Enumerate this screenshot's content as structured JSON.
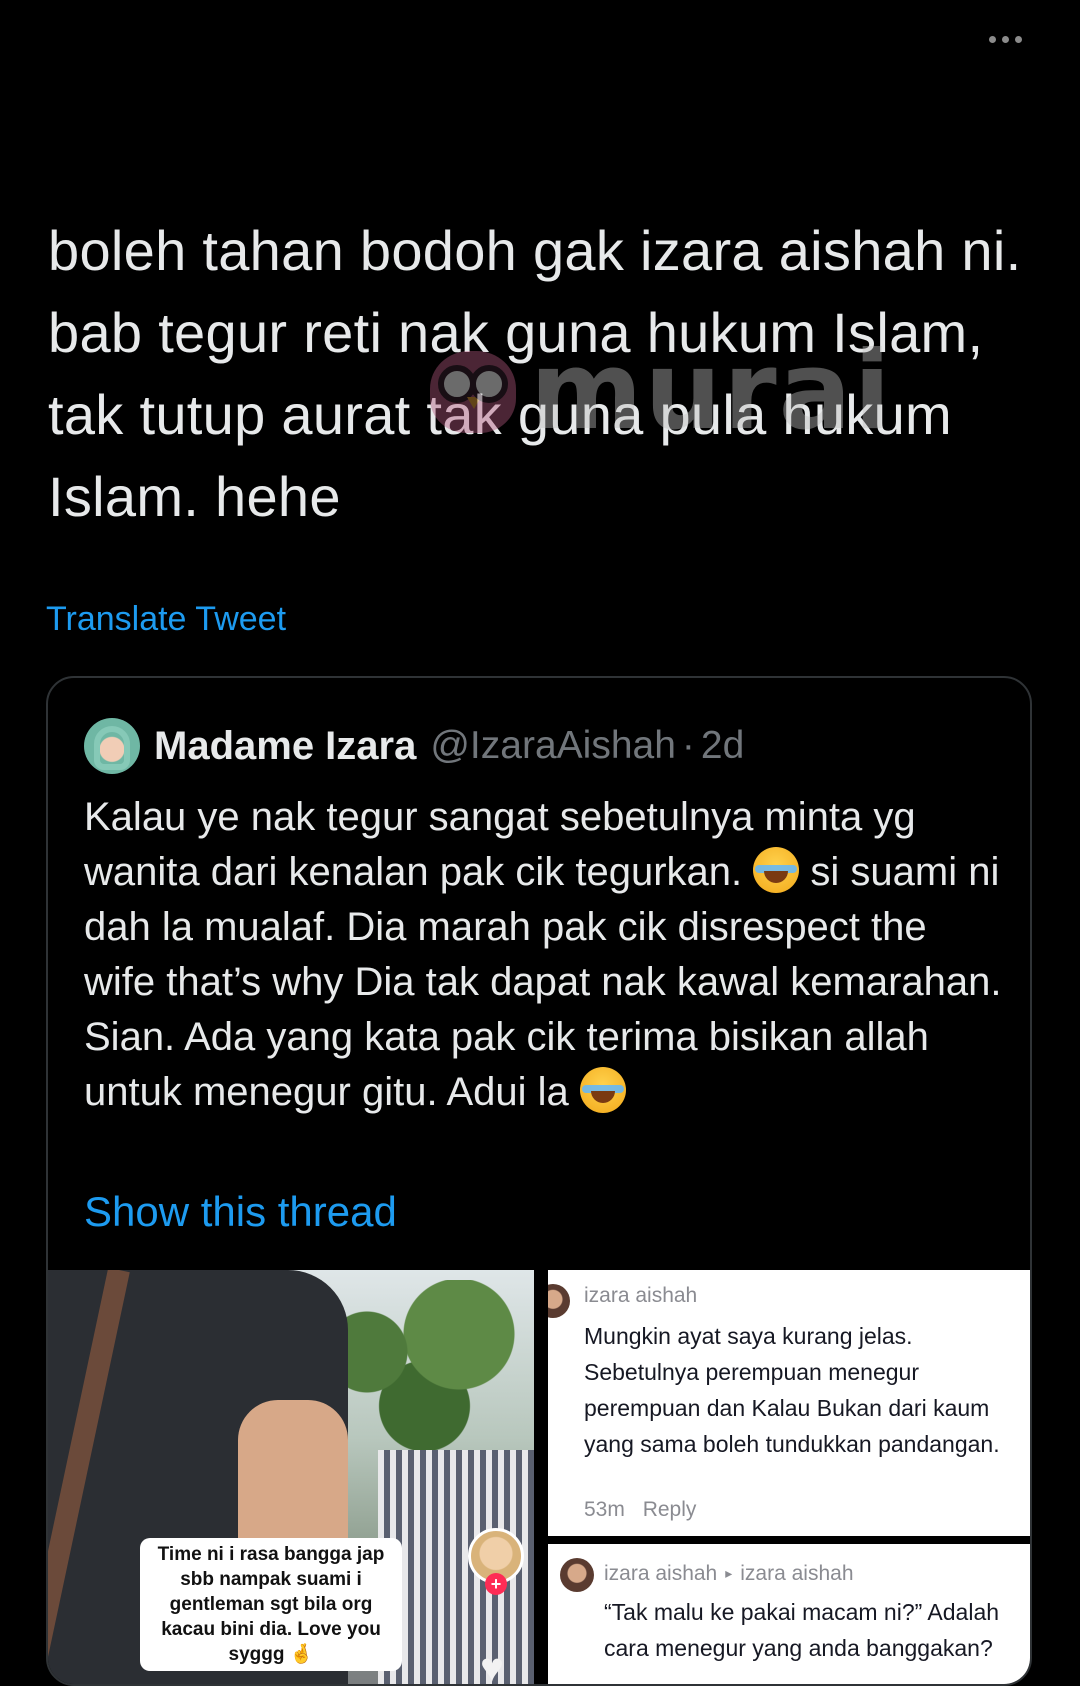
{
  "tweet": {
    "text": "boleh tahan bodoh gak izara aishah ni. bab tegur reti nak guna hukum Islam, tak tutup aurat tak guna pula hukum Islam. hehe",
    "translate_label": "Translate Tweet"
  },
  "watermark": {
    "text": "murai"
  },
  "quote": {
    "name": "Madame Izara",
    "handle": "@IzaraAishah",
    "separator": "·",
    "time": "2d",
    "text_part1": "Kalau ye nak tegur sangat sebetulnya minta  yg wanita dari kenalan pak cik tegurkan.",
    "text_part2": "si suami ni dah la mualaf. Dia marah pak cik disrespect the wife that’s why Dia tak dapat nak kawal kemarahan. Sian. Ada yang kata pak cik terima bisikan allah untuk menegur gitu. Adui la",
    "show_thread": "Show this thread"
  },
  "media": {
    "video_caption": "Time ni i rasa bangga jap sbb nampak suami i gentleman sgt bila org kacau bini dia. Love you syggg 🤞",
    "follow_plus": "+",
    "comment1": {
      "name": "izara aishah",
      "text": "Mungkin ayat saya kurang jelas. Sebetulnya perempuan menegur perempuan dan Kalau Bukan dari kaum yang sama boleh tundukkan pandangan.",
      "time": "53m",
      "reply": "Reply"
    },
    "comment2": {
      "name": "izara aishah",
      "arrow": "▸",
      "reply_to": "izara aishah",
      "text_line1": "“Tak malu ke pakai macam ni?” Adalah",
      "text_line2": "cara menegur yang anda banggakan?"
    }
  },
  "icons": {
    "more": "more-horizontal-icon",
    "emoji": "face-with-tears-of-joy-icon",
    "heart": "heart-icon"
  },
  "colors": {
    "background": "#000000",
    "text": "#e7e9ea",
    "link": "#1d9bf0",
    "secondary": "#71767b",
    "border": "#2f3336"
  }
}
